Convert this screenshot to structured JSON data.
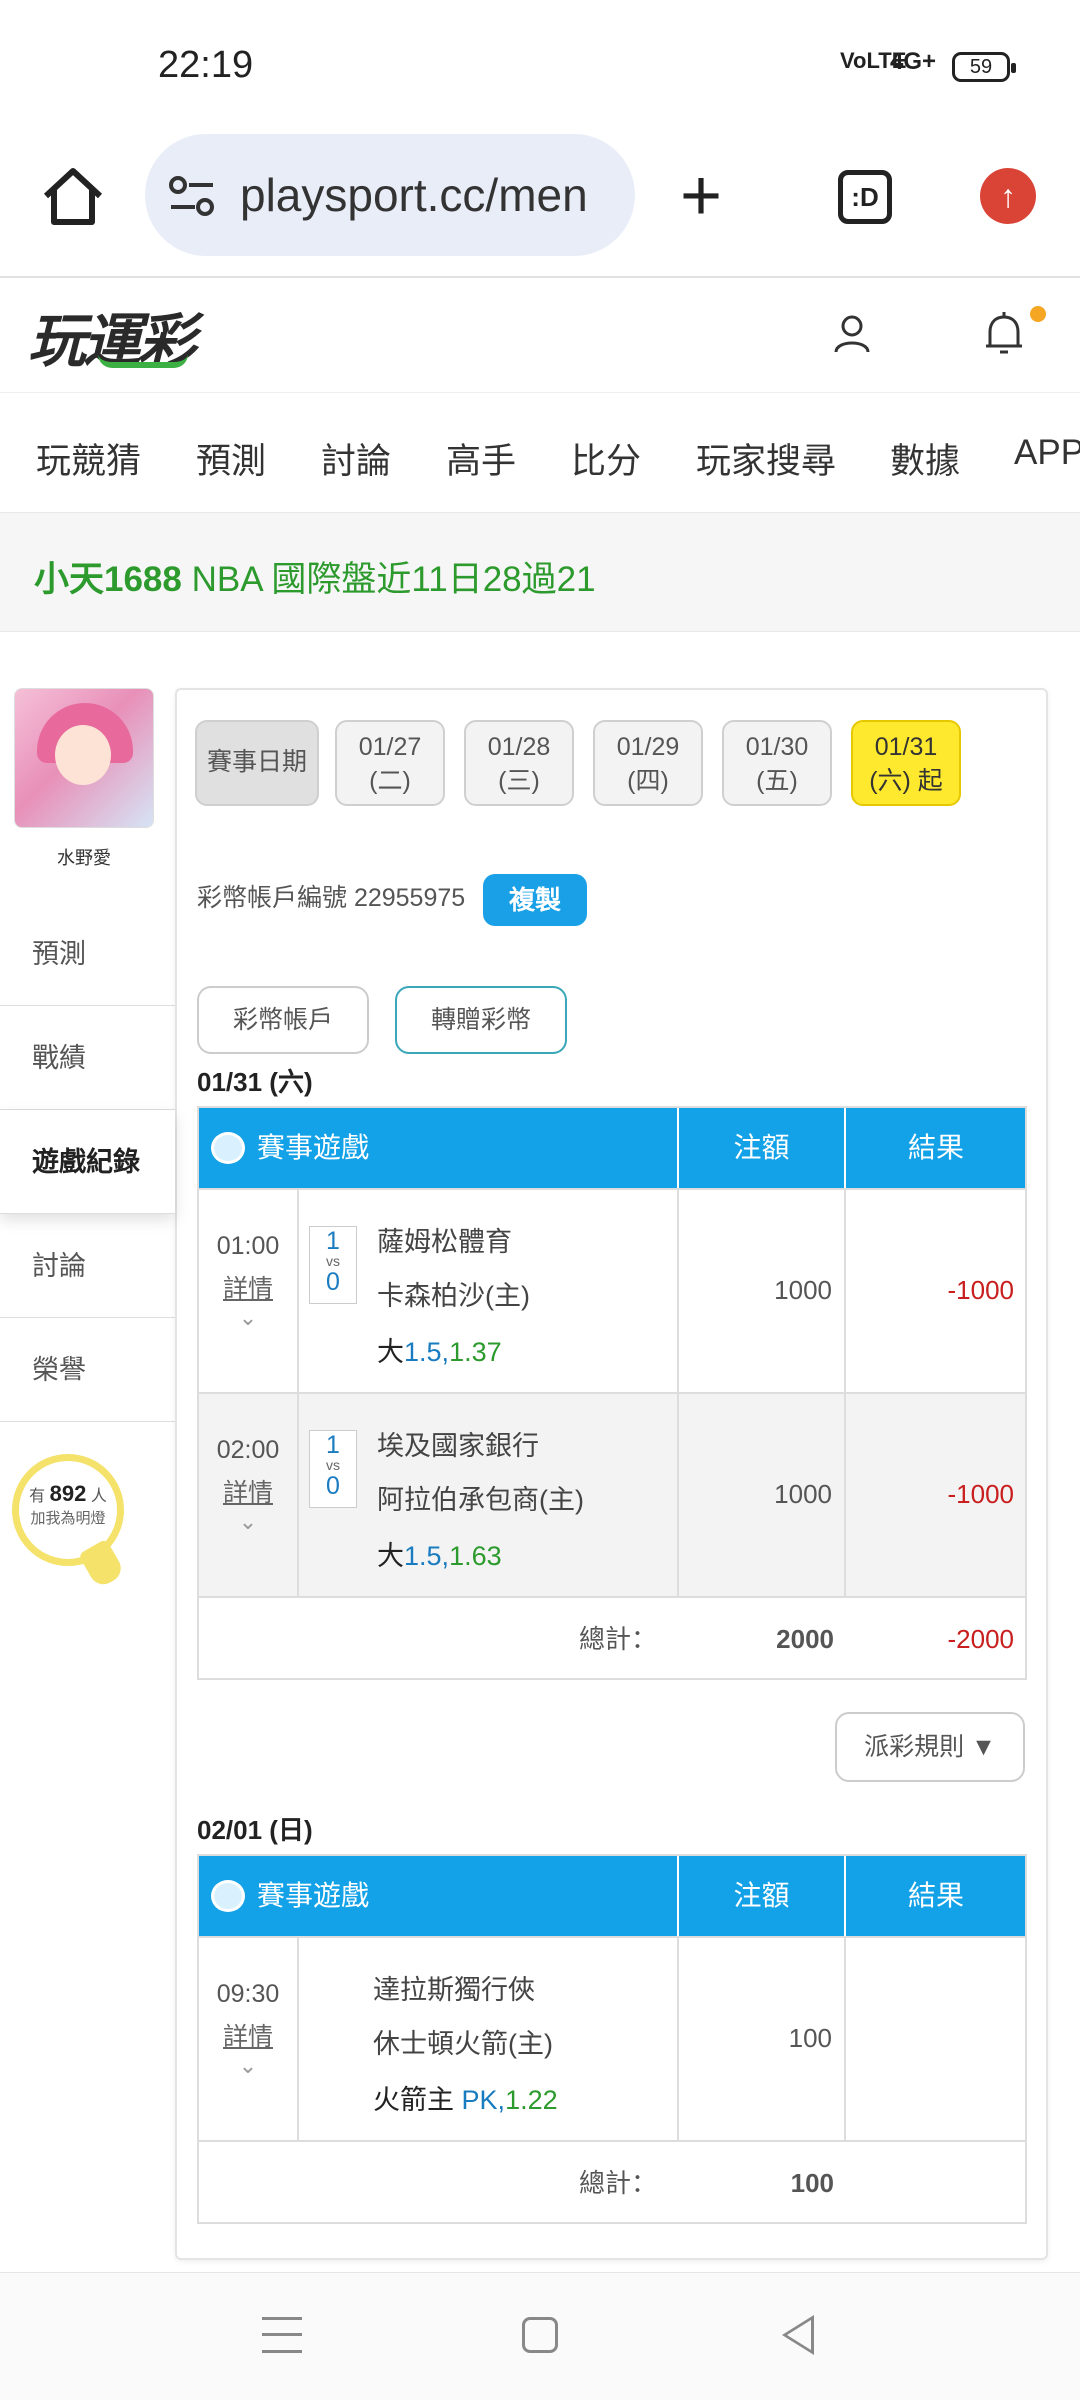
{
  "status_bar": {
    "time": "22:19",
    "signal": "VoLTE",
    "network": "4G+",
    "battery": "59"
  },
  "browser": {
    "url": "playsport.cc/men",
    "tabs_label": ":D"
  },
  "site": {
    "logo": "玩運彩"
  },
  "nav_tabs": [
    "玩競猜",
    "預測",
    "討論",
    "高手",
    "比分",
    "玩家搜尋",
    "數據",
    "APP"
  ],
  "marquee": {
    "text_user": "小天1688",
    "text_rest": "NBA 國際盤近11日28過21"
  },
  "side": {
    "username": "水野愛",
    "menu": [
      "預測",
      "戰績",
      "遊戲紀錄",
      "討論",
      "榮譽"
    ],
    "active_menu": "遊戲紀錄",
    "bulb_prefix": "有",
    "bulb_count": "892",
    "bulb_suffix": "人",
    "bulb_sub": "加我為明燈"
  },
  "dates": {
    "label": "賽事日期",
    "items": [
      {
        "date": "01/27",
        "day": "(二)"
      },
      {
        "date": "01/28",
        "day": "(三)"
      },
      {
        "date": "01/29",
        "day": "(四)"
      },
      {
        "date": "01/30",
        "day": "(五)"
      },
      {
        "date": "01/31",
        "day": "(六) 起"
      }
    ]
  },
  "account": {
    "text": "彩幣帳戶編號 22955975",
    "copy_label": "複製",
    "btn_account": "彩幣帳戶",
    "btn_transfer": "轉贈彩幣"
  },
  "table_headers": {
    "game": "賽事遊戲",
    "amount": "注額",
    "result": "結果"
  },
  "day1": {
    "label": "01/31 (六)",
    "rows": [
      {
        "time": "01:00",
        "detail": "詳情",
        "score_a": "1",
        "vs": "vs",
        "score_b": "0",
        "team_a": "薩姆松體育",
        "team_b": "卡森柏沙(主)",
        "pick_a": "大",
        "pick_b": "1.5",
        "pick_sep": ",",
        "pick_c": "1.37",
        "amount": "1000",
        "result": "-1000"
      },
      {
        "time": "02:00",
        "detail": "詳情",
        "score_a": "1",
        "vs": "vs",
        "score_b": "0",
        "team_a": "埃及國家銀行",
        "team_b": "阿拉伯承包商(主)",
        "pick_a": "大",
        "pick_b": "1.5",
        "pick_sep": ",",
        "pick_c": "1.63",
        "amount": "1000",
        "result": "-1000"
      }
    ],
    "total_label": "總計：",
    "total_amount": "2000",
    "total_result": "-2000"
  },
  "rules_label": "派彩規則 ▼",
  "day2": {
    "label": "02/01 (日)",
    "rows": [
      {
        "time": "09:30",
        "detail": "詳情",
        "team_a": "達拉斯獨行俠",
        "team_b": "休士頓火箭(主)",
        "pick_a": "火箭主 ",
        "pick_b": "PK",
        "pick_sep": ",",
        "pick_c": "1.22",
        "amount": "100",
        "result": ""
      }
    ],
    "total_label": "總計：",
    "total_amount": "100"
  },
  "colors": {
    "accent_blue": "#13a2e8",
    "loss_red": "#c81e1e",
    "green": "#2c9a2c",
    "date_highlight": "#ffe92e"
  }
}
